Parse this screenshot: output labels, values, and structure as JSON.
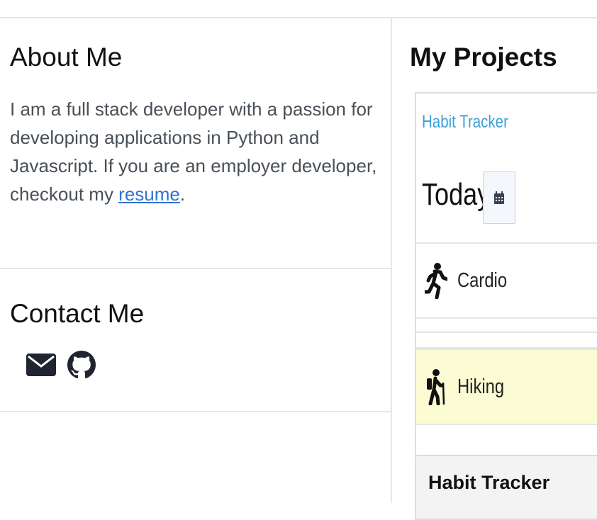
{
  "about": {
    "title": "About Me",
    "text_before_link": "I am a full stack developer with a passion for developing applications in Python and Javascript. If you are an employer developer, checkout my ",
    "link_text": "resume",
    "text_after_link": "."
  },
  "contact": {
    "title": "Contact Me",
    "icons": [
      "envelope-icon",
      "github-icon"
    ]
  },
  "projects": {
    "title": "My Projects",
    "items": [
      {
        "name": "Habit Tracker",
        "screenshot": {
          "brand": "Habit Tracker",
          "heading": "Today",
          "activities": [
            "Cardio",
            "Hiking"
          ]
        }
      }
    ]
  },
  "colors": {
    "link": "#2f74d0",
    "brand": "#3fa0d6",
    "highlight": "#fbfbd4",
    "divider": "#e6e6e6"
  }
}
